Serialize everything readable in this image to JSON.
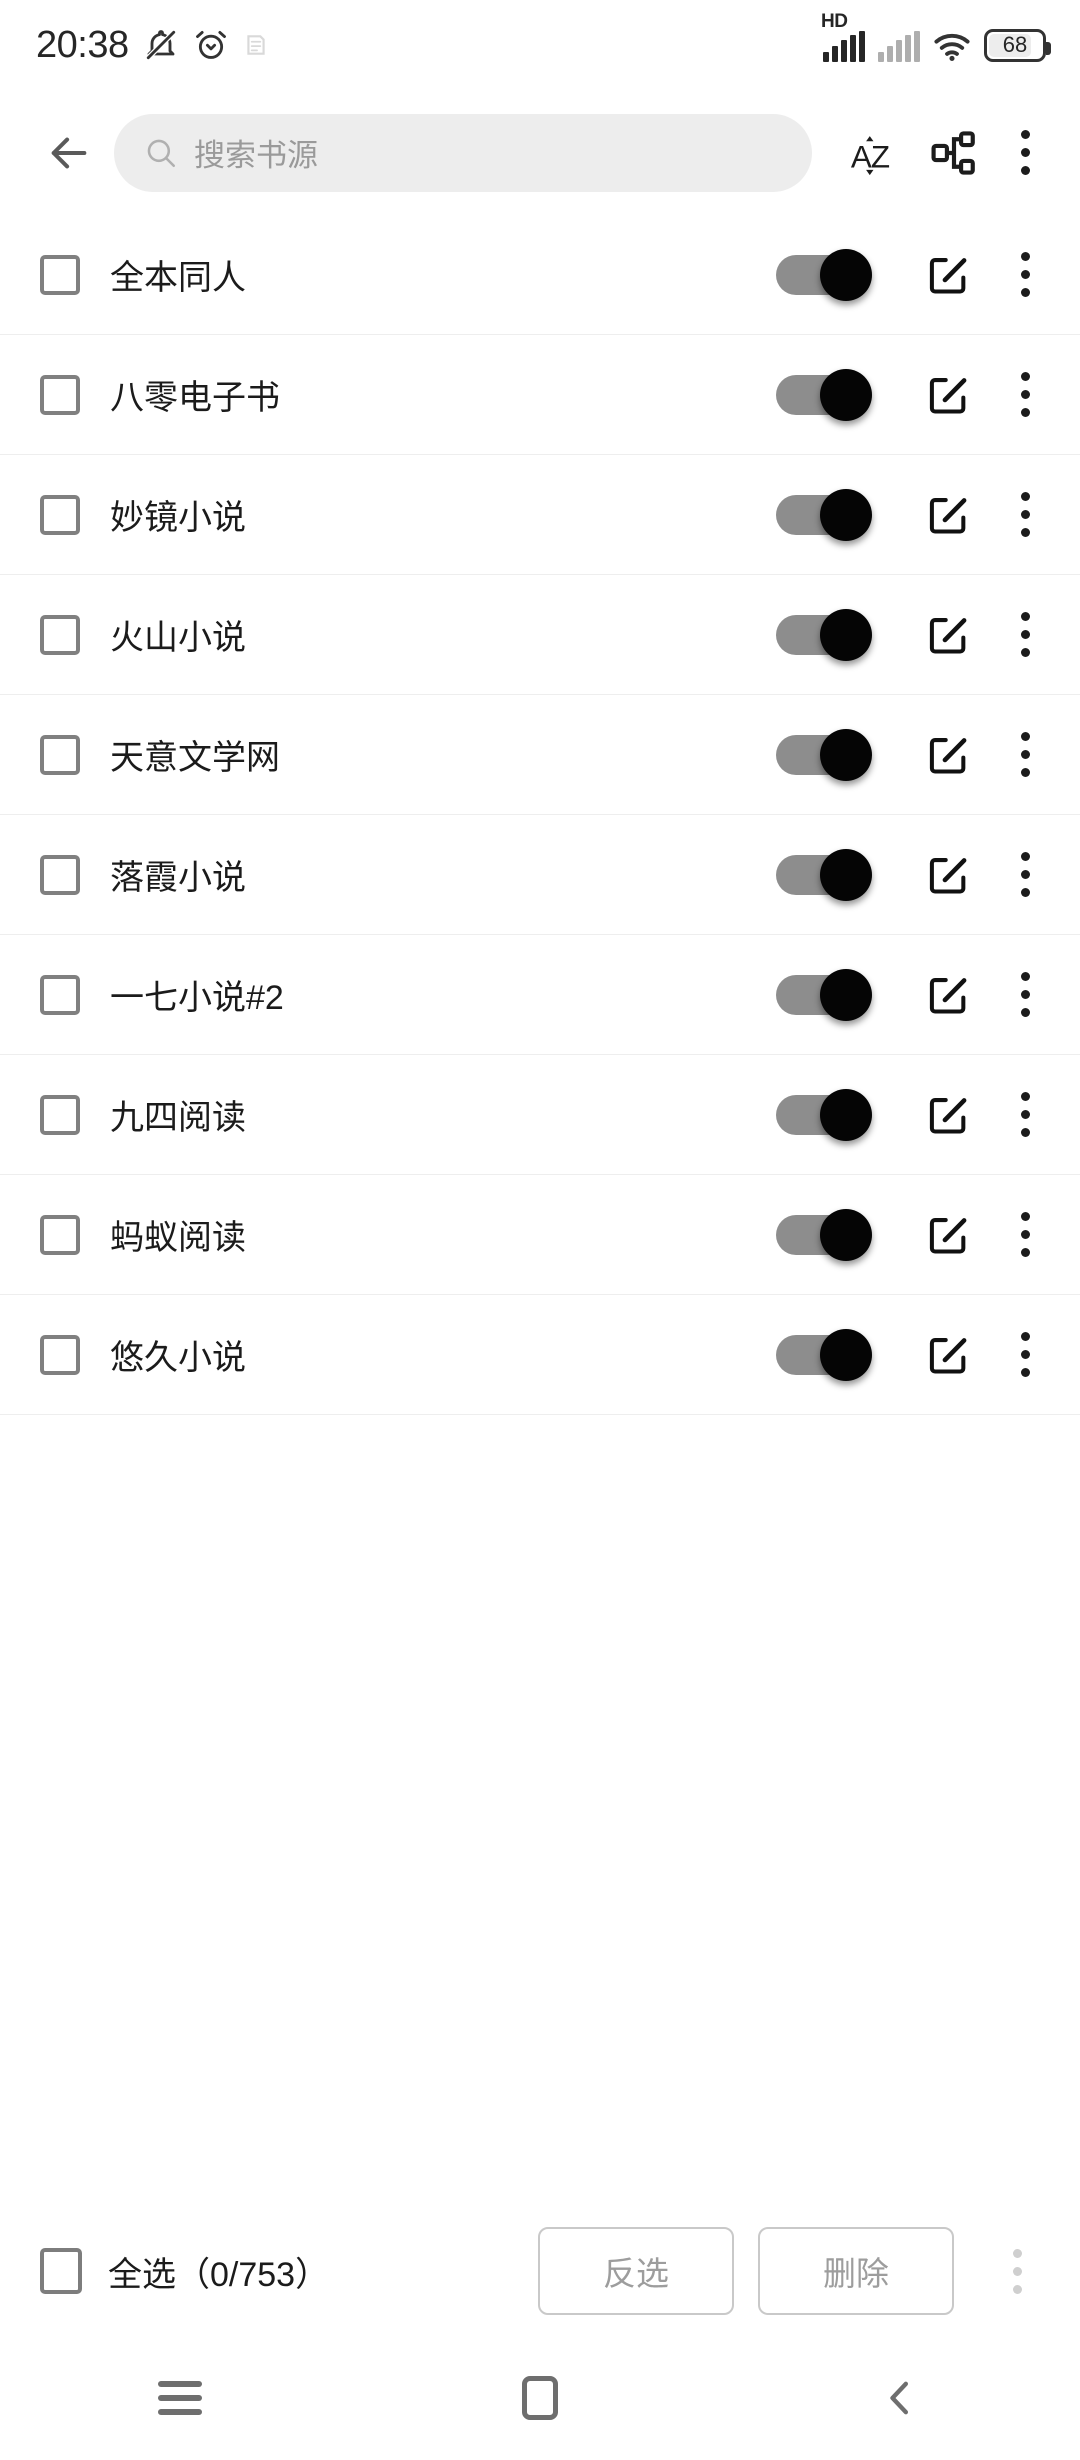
{
  "status_bar": {
    "time": "20:38",
    "left_icons": [
      "silent-bell-icon",
      "alarm-clock-icon",
      "faint-status-icon"
    ],
    "network_label": "HD",
    "right_icons": [
      "signal-bars-icon",
      "signal-bars-secondary-icon",
      "wifi-icon"
    ],
    "battery_level": "68"
  },
  "appbar": {
    "back_icon": "back-arrow-icon",
    "search_placeholder": "搜索书源",
    "search_value": "",
    "search_icon": "search-icon",
    "sort_icon": "sort-az-icon",
    "group_icon": "group-tree-icon",
    "overflow_icon": "overflow-menu-icon"
  },
  "list": {
    "row_switch_on": true,
    "row_edit_icon": "edit-pencil-icon",
    "row_overflow_icon": "overflow-menu-icon",
    "items": [
      {
        "name": "全本同人",
        "checked": false,
        "enabled": true
      },
      {
        "name": "八零电子书",
        "checked": false,
        "enabled": true
      },
      {
        "name": "妙镜小说",
        "checked": false,
        "enabled": true
      },
      {
        "name": "火山小说",
        "checked": false,
        "enabled": true
      },
      {
        "name": "天意文学网",
        "checked": false,
        "enabled": true
      },
      {
        "name": "落霞小说",
        "checked": false,
        "enabled": true
      },
      {
        "name": "一七小说#2",
        "checked": false,
        "enabled": true
      },
      {
        "name": "九四阅读",
        "checked": false,
        "enabled": true
      },
      {
        "name": "蚂蚁阅读",
        "checked": false,
        "enabled": true
      },
      {
        "name": "悠久小说",
        "checked": false,
        "enabled": true
      }
    ]
  },
  "action_bar": {
    "select_all_label": "全选（0/753）",
    "selected_count": 0,
    "total_count": 753,
    "invert_label": "反选",
    "delete_label": "删除",
    "overflow_icon": "overflow-menu-icon"
  },
  "nav_bar": {
    "recents_icon": "recents-menu-icon",
    "home_icon": "home-square-icon",
    "back_icon": "nav-back-icon"
  },
  "colors": {
    "background": "#ffffff",
    "text_primary": "#1b1b1b",
    "text_muted": "#9a9a9a",
    "search_field": "#ededed",
    "divider": "#eeeeee",
    "switch_track": "#8d8d8d",
    "switch_thumb": "#050505"
  }
}
